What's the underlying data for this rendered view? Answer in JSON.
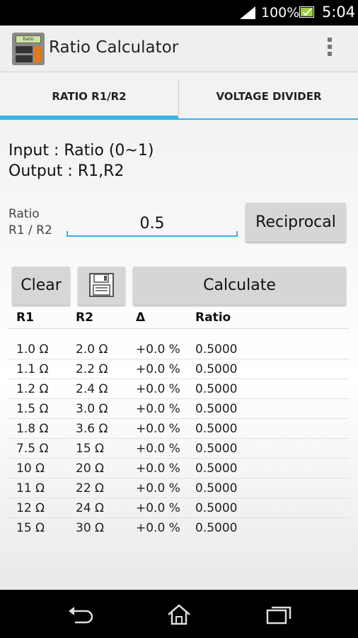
{
  "status_bar": {
    "battery": "100%",
    "time": "5:04",
    "icons": [
      "signal-icon",
      "battery-charging-icon"
    ]
  },
  "action_bar": {
    "title": "Ratio Calculator",
    "app_icon_text": "Ratio",
    "icons": [
      "app-icon",
      "overflow-menu-icon"
    ]
  },
  "tabs": [
    {
      "label": "RATIO R1/R2",
      "selected": true
    },
    {
      "label": "VOLTAGE DIVIDER",
      "selected": false
    }
  ],
  "info": {
    "input_line": "Input : Ratio (0~1)",
    "output_line": "Output : R1,R2"
  },
  "ratio_field": {
    "label_line1": "Ratio",
    "label_line2": "R1 / R2",
    "value": "0.5"
  },
  "buttons": {
    "reciprocal": "Reciprocal",
    "clear": "Clear",
    "save_icon": "save-icon",
    "calculate": "Calculate"
  },
  "table": {
    "headers": [
      "R1",
      "R2",
      "Δ",
      "Ratio"
    ],
    "rows": [
      [
        "1.0 Ω",
        "2.0 Ω",
        "+0.0 %",
        "0.5000"
      ],
      [
        "1.1 Ω",
        "2.2 Ω",
        "+0.0 %",
        "0.5000"
      ],
      [
        "1.2 Ω",
        "2.4 Ω",
        "+0.0 %",
        "0.5000"
      ],
      [
        "1.5 Ω",
        "3.0 Ω",
        "+0.0 %",
        "0.5000"
      ],
      [
        "1.8 Ω",
        "3.6 Ω",
        "+0.0 %",
        "0.5000"
      ],
      [
        "7.5 Ω",
        "15 Ω",
        "+0.0 %",
        "0.5000"
      ],
      [
        "10 Ω",
        "20 Ω",
        "+0.0 %",
        "0.5000"
      ],
      [
        "11 Ω",
        "22 Ω",
        "+0.0 %",
        "0.5000"
      ],
      [
        "12 Ω",
        "24 Ω",
        "+0.0 %",
        "0.5000"
      ],
      [
        "15 Ω",
        "30 Ω",
        "+0.0 %",
        "0.5000"
      ]
    ]
  },
  "nav_bar": {
    "icons": [
      "back-icon",
      "home-icon",
      "recent-apps-icon"
    ]
  },
  "colors": {
    "accent": "#33b5e5",
    "button": "#d6d6d6",
    "action_bar": "#efefef"
  }
}
